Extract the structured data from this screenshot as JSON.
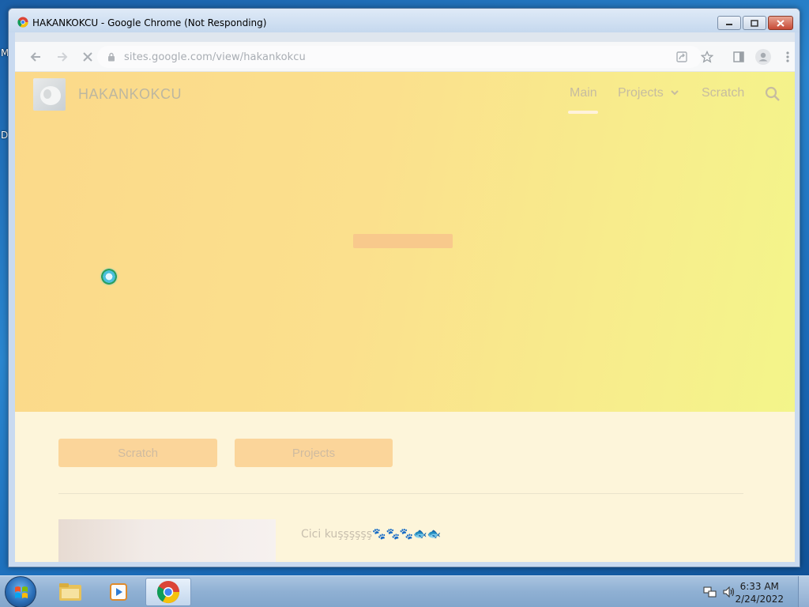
{
  "desktop": {
    "edge_letters": [
      "M",
      "D"
    ]
  },
  "window": {
    "title": "HAKANKOKCU - Google Chrome (Not Responding)"
  },
  "browser": {
    "url": "sites.google.com/view/hakankokcu",
    "icons": [
      "back-icon",
      "forward-icon",
      "stop-loading-icon",
      "lock-icon",
      "share-icon",
      "bookmark-star-icon",
      "side-panel-icon",
      "profile-icon",
      "menu-icon"
    ]
  },
  "site": {
    "title": "HAKANKOKCU",
    "nav": {
      "main": "Main",
      "projects": "Projects",
      "scratch": "Scratch"
    },
    "buttons": {
      "scratch": "Scratch",
      "projects": "Projects"
    },
    "caption": "Cici kuşşşşşş🐾🐾🐾🐟🐟"
  },
  "taskbar": {
    "time": "6:33 AM",
    "date": "2/24/2022"
  },
  "colors": {
    "hero_start": "#fbd98a",
    "hero_end": "#f3f58a",
    "page_bg": "#fdf5da",
    "button_bg": "#fbd59a"
  }
}
